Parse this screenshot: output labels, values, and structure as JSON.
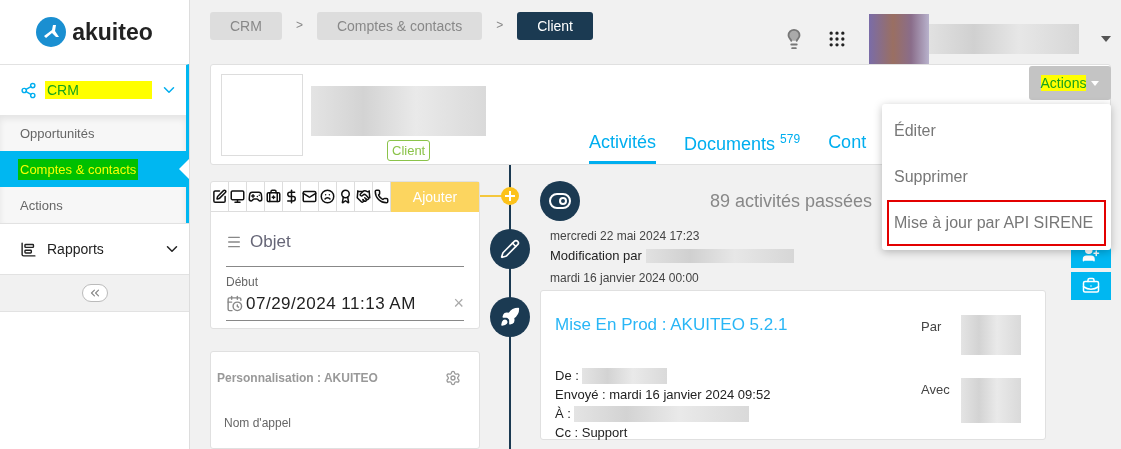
{
  "sidebar": {
    "logo": "akuiteo",
    "sections": [
      {
        "label": "CRM",
        "expanded": true,
        "highlighted": true,
        "children": [
          {
            "label": "Opportunités",
            "selected": false,
            "highlighted": false
          },
          {
            "label": "Comptes & contacts",
            "selected": true,
            "highlighted": true
          },
          {
            "label": "Actions",
            "selected": false,
            "highlighted": false
          }
        ]
      },
      {
        "label": "Rapports",
        "expanded": false,
        "highlighted": false
      }
    ]
  },
  "breadcrumbs": {
    "separator": ">",
    "items": [
      {
        "label": "CRM",
        "selected": false
      },
      {
        "label": "Comptes & contacts",
        "selected": false
      },
      {
        "label": "Client",
        "selected": true
      }
    ]
  },
  "header": {
    "tag": "Client",
    "tabs": [
      {
        "label": "Activités",
        "selected": true
      },
      {
        "label": "Documents",
        "count": "579",
        "selected": false
      },
      {
        "label": "Cont",
        "selected": false
      }
    ],
    "actions_button": {
      "label": "Actions",
      "highlighted": true
    },
    "actions_menu": [
      {
        "label": "Éditer",
        "outlined": false
      },
      {
        "label": "Supprimer",
        "outlined": false
      },
      {
        "label": "Mise à jour par API SIRENE",
        "outlined": true
      }
    ]
  },
  "activity_form": {
    "add_button": "Ajouter",
    "subject_placeholder": "Objet",
    "start_label": "Début",
    "start_value": "07/29/2024 11:13 AM",
    "clear": "×"
  },
  "custom_card": {
    "title": "Personnalisation : AKUITEO",
    "field_label": "Nom d'appel"
  },
  "timeline": {
    "summary": "89 activités passées",
    "entries": [
      {
        "kind": "note",
        "date": "mercredi 22 mai 2024 17:23",
        "text": "Modification par"
      },
      {
        "kind": "email",
        "date": "mardi 16 janvier 2024 00:00",
        "title": "Mise En Prod : AKUITEO 5.2.1",
        "from_label": "De :",
        "sent": "Envoyé : mardi 16 janvier 2024 09:52",
        "to_label": "À :",
        "cc": "Cc : Support",
        "by_label": "Par",
        "with_label": "Avec"
      }
    ]
  }
}
